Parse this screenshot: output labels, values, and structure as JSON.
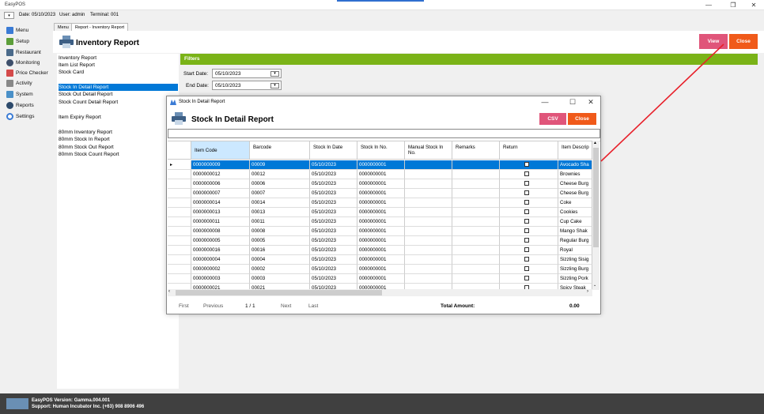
{
  "window": {
    "title": "EasyPOS",
    "minimize": "—",
    "maximize": "❐",
    "close": "✕"
  },
  "infobar": {
    "date": "Date: 05/10/2023",
    "user": "User: admin",
    "terminal": "Terminal: 001"
  },
  "sidebar": [
    {
      "label": "Menu",
      "icon": "menu-icon"
    },
    {
      "label": "Setup",
      "icon": "setup-icon"
    },
    {
      "label": "Restaurant",
      "icon": "restaurant-icon"
    },
    {
      "label": "Monitoring",
      "icon": "monitoring-icon"
    },
    {
      "label": "Price Checker",
      "icon": "price-checker-icon"
    },
    {
      "label": "Activity",
      "icon": "activity-icon"
    },
    {
      "label": "System",
      "icon": "system-icon"
    },
    {
      "label": "Reports",
      "icon": "reports-icon"
    },
    {
      "label": "Settings",
      "icon": "settings-icon"
    }
  ],
  "tabs": [
    {
      "label": "Menu"
    },
    {
      "label": "Report - Inventory Report"
    }
  ],
  "report": {
    "title": "Inventory Report",
    "view_label": "View",
    "close_label": "Close",
    "items": [
      "Inventory Report",
      "Item List Report",
      "Stock Card",
      "Stock In Detail Report",
      "Stock Out Detail Report",
      "Stock Count Detail Report",
      "Item Expiry Report",
      "80mm Inventory Report",
      "80mm Stock In Report",
      "80mm Stock Out Report",
      "80mm Stock Count Report"
    ]
  },
  "filters": {
    "title": "Filters",
    "start_label": "Start Date:",
    "start_value": "05/10/2023",
    "end_label": "End Date:",
    "end_value": "05/10/2023"
  },
  "dialog": {
    "window_title": "Stock In Detail Report",
    "title": "Stock In Detail Report",
    "csv_label": "CSV",
    "close_label": "Close",
    "columns": [
      "Item Code",
      "Barcode",
      "Stock In Date",
      "Stock In No.",
      "Manual Stock In No.",
      "Remarks",
      "Return",
      "Item Descrip"
    ],
    "rows": [
      [
        "0000000009",
        "00009",
        "05/10/2023",
        "0000000001",
        "",
        "",
        false,
        "Avocado Sha"
      ],
      [
        "0000000012",
        "00012",
        "05/10/2023",
        "0000000001",
        "",
        "",
        false,
        "Brownies"
      ],
      [
        "0000000006",
        "00006",
        "05/10/2023",
        "0000000001",
        "",
        "",
        false,
        "Cheese Burg"
      ],
      [
        "0000000007",
        "00007",
        "05/10/2023",
        "0000000001",
        "",
        "",
        false,
        "Cheese Burg"
      ],
      [
        "0000000014",
        "00014",
        "05/10/2023",
        "0000000001",
        "",
        "",
        false,
        "Coke"
      ],
      [
        "0000000013",
        "00013",
        "05/10/2023",
        "0000000001",
        "",
        "",
        false,
        "Cookies"
      ],
      [
        "0000000011",
        "00011",
        "05/10/2023",
        "0000000001",
        "",
        "",
        false,
        "Cup Cake"
      ],
      [
        "0000000008",
        "00008",
        "05/10/2023",
        "0000000001",
        "",
        "",
        false,
        "Mango Shak"
      ],
      [
        "0000000005",
        "00005",
        "05/10/2023",
        "0000000001",
        "",
        "",
        false,
        "Regular Burg"
      ],
      [
        "0000000016",
        "00016",
        "05/10/2023",
        "0000000001",
        "",
        "",
        false,
        "Royal"
      ],
      [
        "0000000004",
        "00004",
        "05/10/2023",
        "0000000001",
        "",
        "",
        false,
        "Sizzling  Sisig"
      ],
      [
        "0000000002",
        "00002",
        "05/10/2023",
        "0000000001",
        "",
        "",
        false,
        "Sizzling Burg"
      ],
      [
        "0000000003",
        "00003",
        "05/10/2023",
        "0000000001",
        "",
        "",
        false,
        "Sizzling Pork"
      ],
      [
        "0000000021",
        "00021",
        "05/10/2023",
        "0000000001",
        "",
        "",
        false,
        "Spicy Steak"
      ]
    ],
    "pager": {
      "first": "First",
      "previous": "Previous",
      "page": "1 / 1",
      "next": "Next",
      "last": "Last"
    },
    "total_label": "Total Amount:",
    "total_value": "0.00"
  },
  "footer": {
    "version": "EasyPOS Version: Gamma.004.001",
    "support": "Support: Human Incubator Inc. (+63) 908 8906 496"
  },
  "colors": {
    "accent_blue": "#0078d7",
    "filters_green": "#7ab317",
    "view_pink": "#e0557a",
    "close_orange": "#f05a1a",
    "annotation_red": "#e8202a"
  }
}
